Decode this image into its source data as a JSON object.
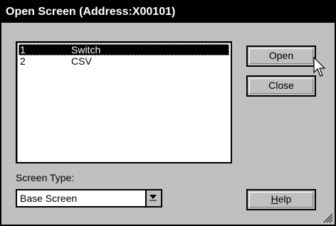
{
  "window": {
    "title": "Open Screen (Address:X00101)"
  },
  "screen_list": {
    "items": [
      {
        "num": "1",
        "name": "Switch",
        "selected": true
      },
      {
        "num": "2",
        "name": "CSV",
        "selected": false
      }
    ]
  },
  "buttons": {
    "open_label": "Open",
    "close_label": "Close",
    "help_label": "Help"
  },
  "screen_type": {
    "label": "Screen Type:",
    "value": "Base Screen"
  },
  "icons": {
    "cursor": "mouse-pointer-icon",
    "dropdown": "chevron-down-icon",
    "resize": "resize-grip-icon"
  }
}
